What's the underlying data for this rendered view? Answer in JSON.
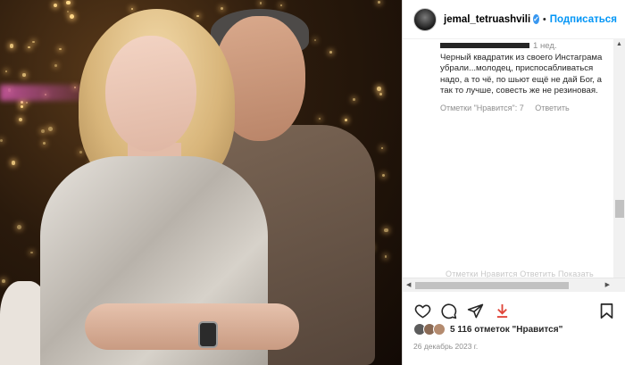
{
  "header": {
    "username": "jemal_tetruashvili",
    "separator": "•",
    "follow_label": "Подписаться"
  },
  "comment": {
    "time": "1 нед.",
    "text": "Черный квадратик из своего Инстаграма убрали...молодец, приспосабливаться надо, а то чё, по шьют ещё не дай Бог, а так то лучше, совесть же не резиновая.",
    "likes_label": "Отметки \"Нравится\": 7",
    "reply_label": "Ответить"
  },
  "faded_row": "Отметки  Нравится  Ответить  Показать",
  "post": {
    "likes_text": "5 116 отметок \"Нравится\"",
    "date": "26 декабрь 2023 г."
  },
  "icons": {
    "like": "heart-icon",
    "comment": "comment-icon",
    "share": "share-icon",
    "download": "download-icon",
    "save": "bookmark-icon"
  },
  "colors": {
    "follow": "#0095f6",
    "verified": "#3897f0",
    "download_icon": "#e0463a"
  }
}
